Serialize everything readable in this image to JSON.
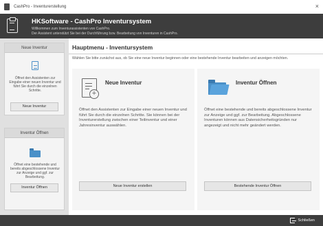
{
  "window": {
    "title": "CashPro - Inventurerstellung",
    "close_glyph": "×"
  },
  "header": {
    "title": "HKSoftware - CashPro Inventursystem",
    "subtitle_line1": "Willkommen zum Inventurassistenten von CashPro.",
    "subtitle_line2": "Der Assistent unterstützt Sie bei der Durchführung bzw. Bearbeitung von Inventuren in CashPro."
  },
  "sidebar": {
    "new": {
      "heading": "Neue Inventur",
      "text": "Öffnet den Assistenten zur Eingabe einer neuen Inventur und führt Sie durch die einzelnen Schritte.",
      "button": "Neue Inventur"
    },
    "open": {
      "heading": "Inventur Öffnen",
      "text": "Öffnet eine bestehende und bereits abgeschlossene Inventur zur Anzeige und ggf. zur Bearbeitung.",
      "button": "Inventur Öffnen"
    }
  },
  "main": {
    "title": "Hauptmenu - Inventursystem",
    "intro": "Wählen Sie bitte zunächst aus, ob Sie eine neue Inventur beginnen oder eine bestehende Inventur bearbeiten und anzeigen möchten.",
    "cards": {
      "new": {
        "title": "Neue Inventur",
        "text": "Öffnet den Assistenten zur Eingabe einer neuen Inventur und führt Sie durch die einzelnen Schritte. Sie können bei der Inventurerstellung zwischen einer Teilinventur und einer Jahresinventur auswählen.",
        "button": "Neue Inventur erstellen"
      },
      "open": {
        "title": "Inventur Öffnen",
        "text": "Öffnet eine bestehende und bereits abgeschlossene Inventur zur Anzeige und ggf. zur Bearbeitung. Abgeschlossene Inventuren können aus Datensicherheitsgründen nur angezeigt und nicht mehr geändert werden.",
        "button": "Bestehende Inventur Öffnen"
      }
    }
  },
  "footer": {
    "close_label": "Schließen"
  },
  "colors": {
    "header_bg": "#3d3d3d",
    "sidebar_bg": "#e0e0e0",
    "card_bg": "#f5f5f5",
    "accent_blue": "#4a90c8"
  },
  "icons": {
    "app": "app-icon",
    "logo": "clipboard-icon",
    "new_inventory": "new-document-icon",
    "open_inventory": "folder-icon",
    "exit": "exit-icon"
  }
}
